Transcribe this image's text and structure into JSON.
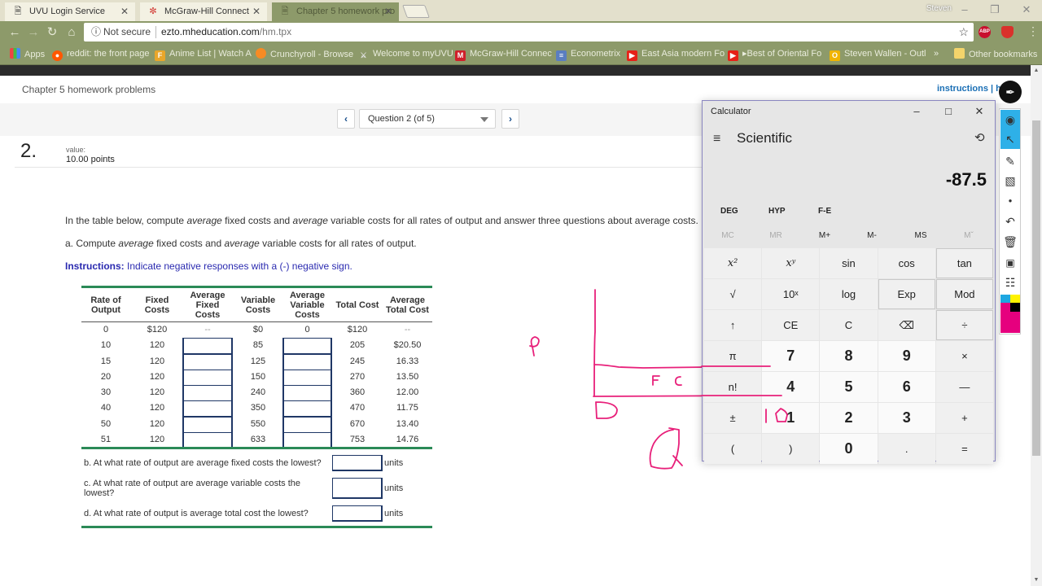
{
  "browser": {
    "tabs": [
      {
        "label": "UVU Login Service",
        "icon": "page-icon",
        "active": false
      },
      {
        "label": "McGraw-Hill Connect",
        "icon": "mcgraw-hill-icon",
        "active": false
      },
      {
        "label": "Chapter 5 homework pro",
        "icon": "page-icon",
        "active": true
      }
    ],
    "profile_name": "Steven",
    "security_label": "Not secure",
    "url_host": "ezto.mheducation.com",
    "url_path": "/hm.tpx",
    "bookmarks": [
      {
        "label": "Apps",
        "icon": "apps-icon"
      },
      {
        "label": "reddit: the front page",
        "icon": "reddit-icon"
      },
      {
        "label": "Anime List | Watch A",
        "icon": "anime-icon"
      },
      {
        "label": "Crunchyroll - Browse",
        "icon": "crunchyroll-icon"
      },
      {
        "label": "Welcome to myUVU",
        "icon": "uvu-icon"
      },
      {
        "label": "McGraw-Hill Connec",
        "icon": "mcgraw-hill-icon"
      },
      {
        "label": "Econometrix",
        "icon": "econometrix-icon"
      },
      {
        "label": "East Asia modern Fo",
        "icon": "youtube-icon"
      },
      {
        "label": "▸Best of Oriental Fo",
        "icon": "youtube-icon"
      },
      {
        "label": "Steven Wallen - Outl",
        "icon": "outlook-icon"
      }
    ],
    "bookmarks_overflow": "»",
    "other_bookmarks": "Other bookmarks"
  },
  "page": {
    "assignment_title": "Chapter 5 homework problems",
    "header_links": "instructions | he",
    "question_select": "Question 2 (of 5)",
    "question_number": "2.",
    "value_label": "value:",
    "value_points": "10.00 points",
    "intro": {
      "p1": "In the table below, compute ",
      "em1": "average",
      "p2": " fixed costs and ",
      "em2": "average",
      "p3": " variable costs for all rates of output and answer three questions about average costs."
    },
    "part_a": {
      "p1": "a. Compute ",
      "em1": "average",
      "p2": " fixed costs and ",
      "em2": "average",
      "p3": " variable costs for all rates of output."
    },
    "instructions_label": "Instructions:",
    "instructions_text": " Indicate negative responses with a (-) negative sign.",
    "table": {
      "headers": [
        "Rate of Output",
        "Fixed Costs",
        "Average Fixed Costs",
        "Variable Costs",
        "Average Variable Costs",
        "Total Cost",
        "Average Total Cost"
      ],
      "rows": [
        {
          "output": "0",
          "fixed": "$120",
          "afc": "--",
          "variable": "$0",
          "avc": "0",
          "total": "$120",
          "atc": "--",
          "editable": false
        },
        {
          "output": "10",
          "fixed": "120",
          "afc": "",
          "variable": "85",
          "avc": "",
          "total": "205",
          "atc": "$20.50",
          "editable": true
        },
        {
          "output": "15",
          "fixed": "120",
          "afc": "",
          "variable": "125",
          "avc": "",
          "total": "245",
          "atc": "16.33",
          "editable": true
        },
        {
          "output": "20",
          "fixed": "120",
          "afc": "",
          "variable": "150",
          "avc": "",
          "total": "270",
          "atc": "13.50",
          "editable": true
        },
        {
          "output": "30",
          "fixed": "120",
          "afc": "",
          "variable": "240",
          "avc": "",
          "total": "360",
          "atc": "12.00",
          "editable": true
        },
        {
          "output": "40",
          "fixed": "120",
          "afc": "",
          "variable": "350",
          "avc": "",
          "total": "470",
          "atc": "11.75",
          "editable": true
        },
        {
          "output": "50",
          "fixed": "120",
          "afc": "",
          "variable": "550",
          "avc": "",
          "total": "670",
          "atc": "13.40",
          "editable": true
        },
        {
          "output": "51",
          "fixed": "120",
          "afc": "",
          "variable": "633",
          "avc": "",
          "total": "753",
          "atc": "14.76",
          "editable": true
        }
      ]
    },
    "questions": [
      {
        "text": "b. At what rate of output are average fixed costs the lowest?",
        "value": "",
        "unit": "units"
      },
      {
        "text": "c. At what rate of output are average variable costs the lowest?",
        "value": "",
        "unit": "units"
      },
      {
        "text": "d. At what rate of output is average total cost the lowest?",
        "value": "",
        "unit": "units"
      }
    ]
  },
  "ink": {
    "color": "#e8207a",
    "labels": [
      "P",
      "FC",
      "D",
      "Q"
    ]
  },
  "calculator": {
    "title": "Calculator",
    "mode": "Scientific",
    "display": "-87.5",
    "flags": [
      "DEG",
      "HYP",
      "F-E"
    ],
    "memory": [
      {
        "label": "MC",
        "enabled": false
      },
      {
        "label": "MR",
        "enabled": false
      },
      {
        "label": "M+",
        "enabled": true
      },
      {
        "label": "M-",
        "enabled": true
      },
      {
        "label": "MS",
        "enabled": true
      },
      {
        "label": "Mˇ",
        "enabled": false
      }
    ],
    "keys": [
      "x²",
      "xʸ",
      "sin",
      "cos",
      "tan",
      "√",
      "10ˣ",
      "log",
      "Exp",
      "Mod",
      "↑",
      "CE",
      "C",
      "⌫",
      "÷",
      "π",
      "7",
      "8",
      "9",
      "×",
      "n!",
      "4",
      "5",
      "6",
      "—",
      "±",
      "1",
      "2",
      "3",
      "+",
      "(",
      ")",
      "0",
      ".",
      "="
    ]
  },
  "palette": {
    "tools": [
      "eye-icon",
      "pointer-icon",
      "pen-icon",
      "eraser-icon",
      "dot-size-icon",
      "undo-icon",
      "trash-icon",
      "camera-icon",
      "clipboard-icon"
    ],
    "colors": [
      "#1ea7e1",
      "#fff200",
      "#e6007e",
      "#000000"
    ]
  }
}
